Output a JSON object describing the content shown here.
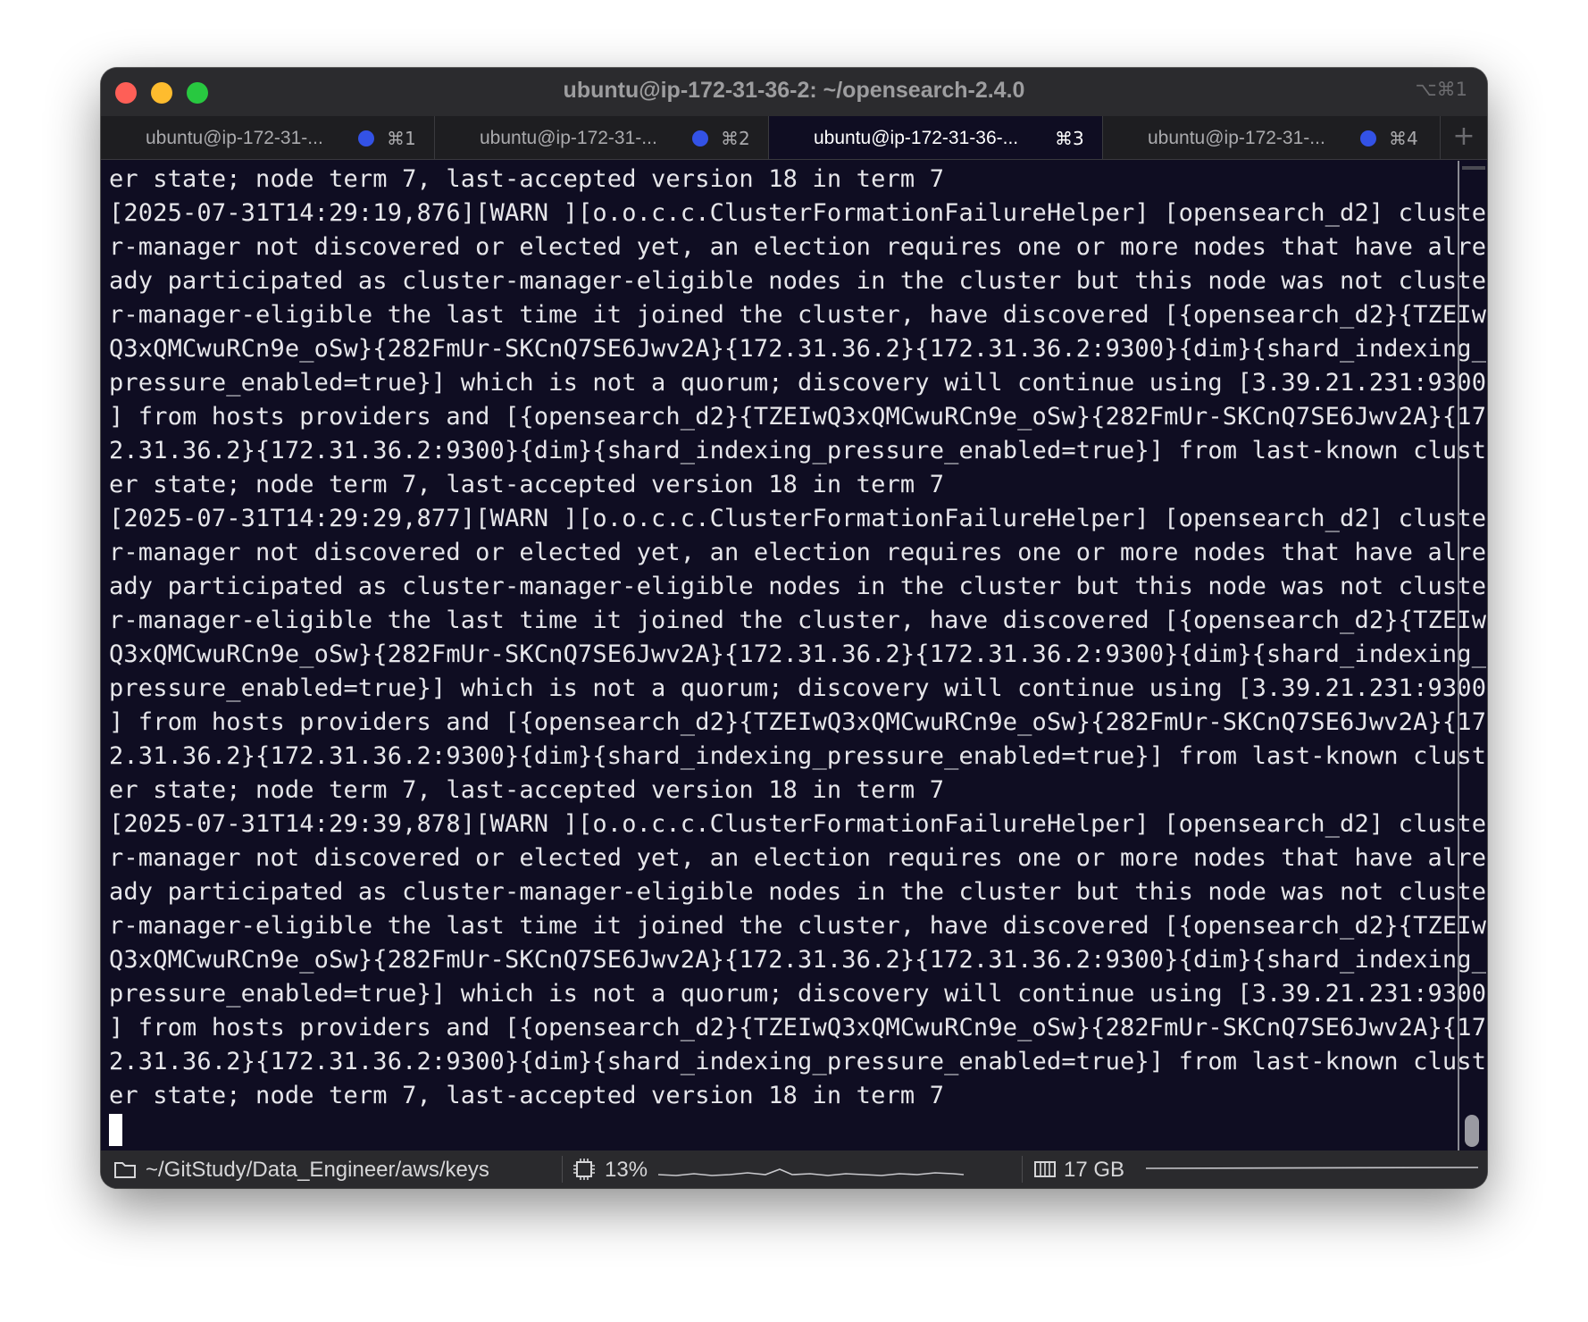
{
  "window": {
    "title": "ubuntu@ip-172-31-36-2: ~/opensearch-2.4.0",
    "shortcut": "⌥⌘1"
  },
  "tabs": [
    {
      "label": "ubuntu@ip-172-31-...",
      "key": "⌘1",
      "active": false,
      "has_activity_dot": true
    },
    {
      "label": "ubuntu@ip-172-31-...",
      "key": "⌘2",
      "active": false,
      "has_activity_dot": true
    },
    {
      "label": "ubuntu@ip-172-31-36-...",
      "key": "⌘3",
      "active": true,
      "has_activity_dot": false
    },
    {
      "label": "ubuntu@ip-172-31-...",
      "key": "⌘4",
      "active": false,
      "has_activity_dot": true
    }
  ],
  "new_tab_label": "+",
  "terminal": {
    "lines": [
      "er state; node term 7, last-accepted version 18 in term 7",
      "[2025-07-31T14:29:19,876][WARN ][o.o.c.c.ClusterFormationFailureHelper] [opensearch_d2] cluste",
      "r-manager not discovered or elected yet, an election requires one or more nodes that have alre",
      "ady participated as cluster-manager-eligible nodes in the cluster but this node was not cluste",
      "r-manager-eligible the last time it joined the cluster, have discovered [{opensearch_d2}{TZEIw",
      "Q3xQMCwuRCn9e_oSw}{282FmUr-SKCnQ7SE6Jwv2A}{172.31.36.2}{172.31.36.2:9300}{dim}{shard_indexing_",
      "pressure_enabled=true}] which is not a quorum; discovery will continue using [3.39.21.231:9300",
      "] from hosts providers and [{opensearch_d2}{TZEIwQ3xQMCwuRCn9e_oSw}{282FmUr-SKCnQ7SE6Jwv2A}{17",
      "2.31.36.2}{172.31.36.2:9300}{dim}{shard_indexing_pressure_enabled=true}] from last-known clust",
      "er state; node term 7, last-accepted version 18 in term 7",
      "[2025-07-31T14:29:29,877][WARN ][o.o.c.c.ClusterFormationFailureHelper] [opensearch_d2] cluste",
      "r-manager not discovered or elected yet, an election requires one or more nodes that have alre",
      "ady participated as cluster-manager-eligible nodes in the cluster but this node was not cluste",
      "r-manager-eligible the last time it joined the cluster, have discovered [{opensearch_d2}{TZEIw",
      "Q3xQMCwuRCn9e_oSw}{282FmUr-SKCnQ7SE6Jwv2A}{172.31.36.2}{172.31.36.2:9300}{dim}{shard_indexing_",
      "pressure_enabled=true}] which is not a quorum; discovery will continue using [3.39.21.231:9300",
      "] from hosts providers and [{opensearch_d2}{TZEIwQ3xQMCwuRCn9e_oSw}{282FmUr-SKCnQ7SE6Jwv2A}{17",
      "2.31.36.2}{172.31.36.2:9300}{dim}{shard_indexing_pressure_enabled=true}] from last-known clust",
      "er state; node term 7, last-accepted version 18 in term 7",
      "[2025-07-31T14:29:39,878][WARN ][o.o.c.c.ClusterFormationFailureHelper] [opensearch_d2] cluste",
      "r-manager not discovered or elected yet, an election requires one or more nodes that have alre",
      "ady participated as cluster-manager-eligible nodes in the cluster but this node was not cluste",
      "r-manager-eligible the last time it joined the cluster, have discovered [{opensearch_d2}{TZEIw",
      "Q3xQMCwuRCn9e_oSw}{282FmUr-SKCnQ7SE6Jwv2A}{172.31.36.2}{172.31.36.2:9300}{dim}{shard_indexing_",
      "pressure_enabled=true}] which is not a quorum; discovery will continue using [3.39.21.231:9300",
      "] from hosts providers and [{opensearch_d2}{TZEIwQ3xQMCwuRCn9e_oSw}{282FmUr-SKCnQ7SE6Jwv2A}{17",
      "2.31.36.2}{172.31.36.2:9300}{dim}{shard_indexing_pressure_enabled=true}] from last-known clust",
      "er state; node term 7, last-accepted version 18 in term 7"
    ]
  },
  "status": {
    "path": "~/GitStudy/Data_Engineer/aws/keys",
    "cpu": "13%",
    "memory": "17 GB",
    "icons": {
      "path": "folder-icon",
      "cpu": "cpu-icon",
      "memory": "memory-icon"
    }
  },
  "colors": {
    "terminal_bg": "#0f0d22",
    "terminal_fg": "#e6e6ea",
    "tab_dot": "#3352e6",
    "close": "#fe5f57",
    "minimize": "#febc2e",
    "maximize": "#28c840"
  }
}
